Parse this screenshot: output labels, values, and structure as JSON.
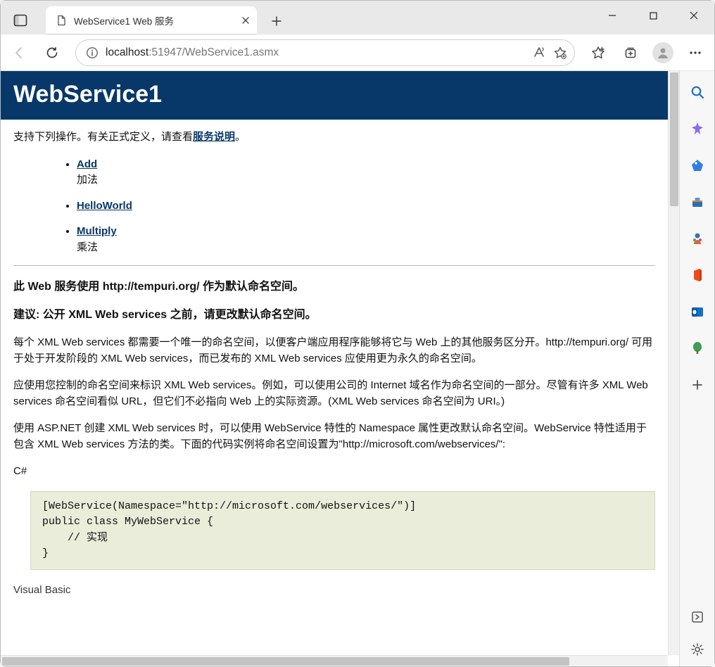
{
  "browser": {
    "tab_title": "WebService1 Web 服务",
    "url_host": "localhost",
    "url_port_path": ":51947/WebService1.asmx"
  },
  "page": {
    "title": "WebService1",
    "intro_before": "支持下列操作。有关正式定义，请查看",
    "intro_link": "服务说明",
    "intro_after": "。",
    "operations": [
      {
        "name": "Add",
        "desc": "加法"
      },
      {
        "name": "HelloWorld",
        "desc": ""
      },
      {
        "name": "Multiply",
        "desc": "乘法"
      }
    ],
    "ns_heading": "此 Web 服务使用 http://tempuri.org/ 作为默认命名空间。",
    "ns_advice": "建议: 公开 XML Web services 之前，请更改默认命名空间。",
    "para1": "每个 XML Web services 都需要一个唯一的命名空间，以便客户端应用程序能够将它与 Web 上的其他服务区分开。http://tempuri.org/ 可用于处于开发阶段的 XML Web services，而已发布的 XML Web services 应使用更为永久的命名空间。",
    "para2": "应使用您控制的命名空间来标识 XML Web services。例如，可以使用公司的 Internet 域名作为命名空间的一部分。尽管有许多 XML Web services 命名空间看似 URL，但它们不必指向 Web 上的实际资源。(XML Web services 命名空间为 URI。)",
    "para3": "使用 ASP.NET 创建 XML Web services 时，可以使用 WebService 特性的 Namespace 属性更改默认命名空间。WebService 特性适用于包含 XML Web services 方法的类。下面的代码实例将命名空间设置为\"http://microsoft.com/webservices/\":",
    "lang_cs": "C#",
    "code_cs": "[WebService(Namespace=\"http://microsoft.com/webservices/\")]\npublic class MyWebService {\n    // 实现\n}",
    "lang_vb": "Visual Basic"
  }
}
